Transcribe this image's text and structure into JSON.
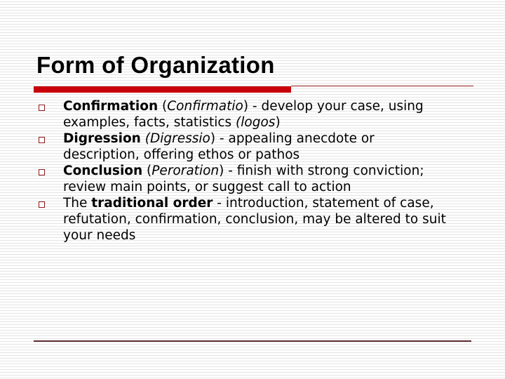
{
  "slide": {
    "title": "Form of Organization",
    "items": [
      {
        "bold": "Confirmation",
        "open": " (",
        "italic": "Confirmatio",
        "mid": ") - develop your case, using examples, facts, statistics ",
        "italic2": "(logos",
        "close": ")"
      },
      {
        "bold": "Digression",
        "open": " ",
        "italic": "(Digressio",
        "mid": ") - appealing anecdote or description, offering ethos or pathos",
        "italic2": "",
        "close": ""
      },
      {
        "bold": "Conclusion",
        "open": " (",
        "italic": "Peroration",
        "mid": ") - finish with strong conviction; review main points, or suggest call to action",
        "italic2": "",
        "close": ""
      },
      {
        "prefix": "The ",
        "bold": "traditional order",
        "mid": " - introduction, statement of case, refutation, confirmation, conclusion, may be altered to suit your needs"
      }
    ]
  },
  "colors": {
    "accent": "#c8000a",
    "bullet": "#8b1a1a",
    "footer_rule": "#5a2a30"
  }
}
